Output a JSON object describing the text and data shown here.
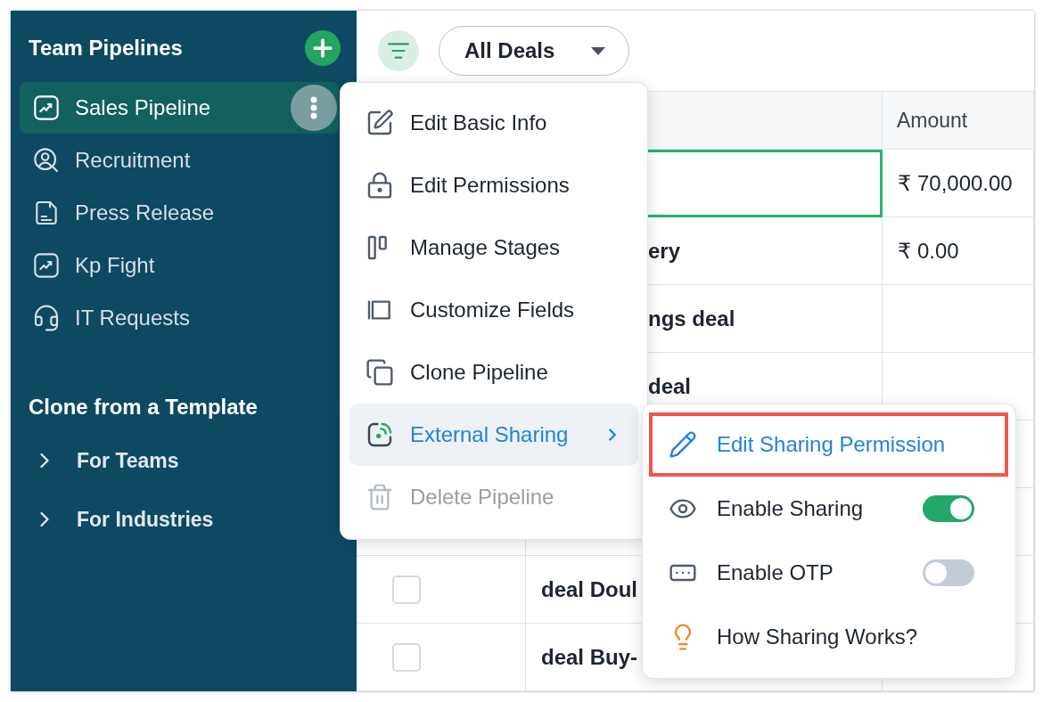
{
  "sidebar": {
    "title": "Team Pipelines",
    "items": [
      {
        "label": "Sales Pipeline",
        "selected": true
      },
      {
        "label": "Recruitment",
        "selected": false
      },
      {
        "label": "Press Release",
        "selected": false
      },
      {
        "label": "Kp Fight",
        "selected": false
      },
      {
        "label": "IT Requests",
        "selected": false
      }
    ],
    "template_title": "Clone from a Template",
    "templates": [
      {
        "label": "For Teams",
        "expanded": false
      },
      {
        "label": "For Industries",
        "expanded": false
      }
    ]
  },
  "toolbar": {
    "view": "All Deals"
  },
  "table": {
    "columns": [
      "",
      "Amount"
    ],
    "rows": [
      {
        "kind": "clipped",
        "name": "",
        "amount": "₹ 70,000.00",
        "editing": true
      },
      {
        "kind": "clipped",
        "name": "ery",
        "amount": "₹ 0.00",
        "editing": false
      },
      {
        "kind": "clipped",
        "name": "ngs deal",
        "editing": false
      },
      {
        "kind": "clipped",
        "name": "deal",
        "editing": false
      },
      {
        "kind": "plain"
      },
      {
        "kind": "plain"
      },
      {
        "kind": "plain",
        "name": "deal Doul",
        "checked": false,
        "editing": false
      },
      {
        "kind": "plain",
        "name": "deal Buy-",
        "checked": false,
        "editing": false
      }
    ]
  },
  "menu": [
    {
      "kind": "action",
      "label": "Edit Basic Info",
      "disabled": false,
      "selected": false
    },
    {
      "kind": "action",
      "label": "Edit Permissions",
      "disabled": false,
      "selected": false
    },
    {
      "kind": "action",
      "label": "Manage Stages",
      "disabled": false,
      "selected": false
    },
    {
      "kind": "action",
      "label": "Customize Fields",
      "disabled": false,
      "selected": false
    },
    {
      "kind": "action",
      "label": "Clone Pipeline",
      "disabled": false,
      "selected": false
    },
    {
      "kind": "submenu",
      "label": "External Sharing",
      "disabled": false,
      "selected": true
    },
    {
      "kind": "action",
      "label": "Delete Pipeline",
      "disabled": true,
      "selected": false
    }
  ],
  "submenu": [
    {
      "kind": "action",
      "label": "Edit Sharing Permission",
      "highlighted": true
    },
    {
      "kind": "toggle",
      "label": "Enable Sharing",
      "on": true
    },
    {
      "kind": "toggle",
      "label": "Enable OTP",
      "on": false
    },
    {
      "kind": "action",
      "label": "How Sharing Works?",
      "highlighted": false
    }
  ]
}
